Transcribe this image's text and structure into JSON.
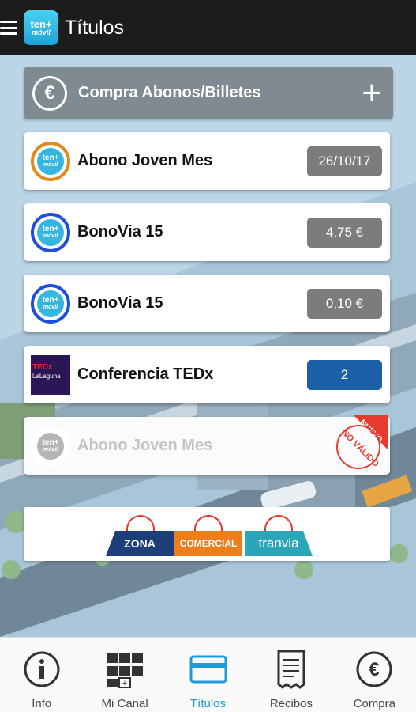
{
  "header": {
    "title": "Títulos",
    "logo_line1": "ten+",
    "logo_line2": "móvil"
  },
  "buy_button": {
    "label": "Compra Abonos/Billetes",
    "icon": "euro-icon",
    "action_icon": "plus-icon"
  },
  "tickets": [
    {
      "name": "Abono Joven Mes",
      "value": "26/10/17",
      "logo_color": "#e08a1e",
      "badge_color": "#7c7c7c"
    },
    {
      "name": "BonoVia 15",
      "value": "4,75 €",
      "logo_color": "#1f4fd8",
      "badge_color": "#7c7c7c"
    },
    {
      "name": "BonoVia 15",
      "value": "0,10 €",
      "logo_color": "#1f4fd8",
      "badge_color": "#7c7c7c"
    },
    {
      "name": "Conferencia TEDx",
      "value": "2",
      "logo_text": "TEDx",
      "logo_sub": "LaLaguna",
      "badge_color": "#1b5fa6"
    },
    {
      "name": "Abono Joven Mes",
      "value": "",
      "status": "disabled",
      "stamp_line1": "NUEVO",
      "stamp_line2": "NO VÁLIDO"
    }
  ],
  "ten_logo": {
    "line1": "ten+",
    "line2": "móvil"
  },
  "banner": {
    "segments": [
      "ZONA",
      "COMERCIAL",
      "tranvia"
    ]
  },
  "bottom_nav": [
    {
      "label": "Info",
      "icon": "info-icon",
      "active": false
    },
    {
      "label": "Mi Canal",
      "icon": "channel-grid-icon",
      "active": false
    },
    {
      "label": "Títulos",
      "icon": "card-icon",
      "active": true
    },
    {
      "label": "Recibos",
      "icon": "receipt-icon",
      "active": false
    },
    {
      "label": "Compra",
      "icon": "euro-icon",
      "active": false
    }
  ],
  "colors": {
    "accent": "#1d9bd6",
    "header_bg": "#1c1c1c",
    "buy_bg": "#7f8a91"
  }
}
